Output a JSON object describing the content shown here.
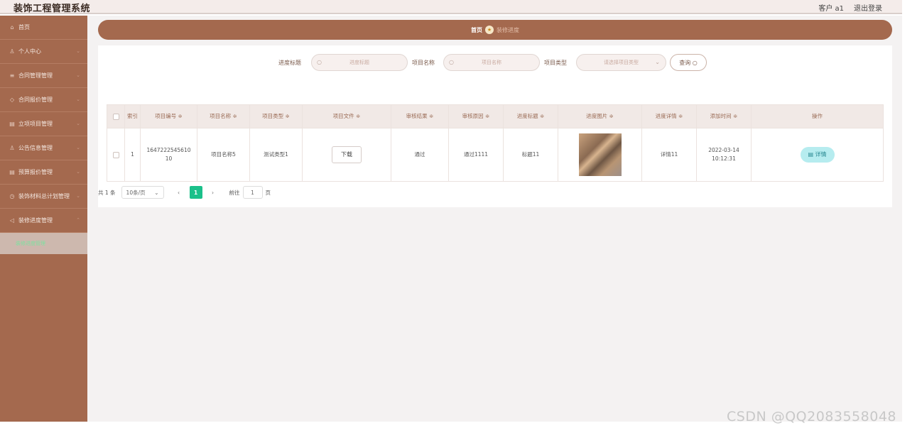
{
  "app": {
    "title": "装饰工程管理系统"
  },
  "topbar": {
    "user": "客户 a1",
    "logout": "退出登录"
  },
  "sidebar": {
    "items": [
      {
        "icon": "⌂",
        "label": "首页"
      },
      {
        "icon": "♙",
        "label": "个人中心"
      },
      {
        "icon": "≡",
        "label": "合同管理管理"
      },
      {
        "icon": "◇",
        "label": "合同报价管理"
      },
      {
        "icon": "▤",
        "label": "立项项目管理"
      },
      {
        "icon": "♙",
        "label": "公告信息管理"
      },
      {
        "icon": "▤",
        "label": "预算报价管理"
      },
      {
        "icon": "◷",
        "label": "装饰材料总计划管理"
      },
      {
        "icon": "◁",
        "label": "装修进度管理"
      }
    ],
    "subitem": "装修进度管理"
  },
  "breadcrumb": {
    "home": "首页",
    "current": "装修进度"
  },
  "search": {
    "title_label": "进度标题",
    "title_placeholder": "进度标题",
    "project_label": "项目名称",
    "project_placeholder": "项目名称",
    "type_label": "项目类型",
    "type_placeholder": "请选择项目类型",
    "query_button": "查询"
  },
  "table": {
    "headers": [
      "索引",
      "项目编号 ≑",
      "项目名称 ≑",
      "项目类型 ≑",
      "项目文件 ≑",
      "审核结果 ≑",
      "审核原因 ≑",
      "进度标题 ≑",
      "进度图片 ≑",
      "进度详情 ≑",
      "添加时间 ≑",
      "操作"
    ],
    "rows": [
      {
        "index": "1",
        "project_no": "1647222545610 10",
        "project_name": "项目名称5",
        "project_type": "测试类型1",
        "file_button": "下载",
        "review_result": "通过",
        "review_reason": "通过1111",
        "progress_title": "标题11",
        "progress_detail": "详情11",
        "added_time": "2022-03-14 10:12:31",
        "action": "详情"
      }
    ]
  },
  "pager": {
    "total": "共 1 条",
    "page_size": "10条/页",
    "current_page": "1",
    "goto_label": "前往",
    "goto_value": "1",
    "page_unit": "页"
  },
  "watermark": "CSDN @QQ2083558048",
  "colors": {
    "sidebar": "#a4694e",
    "accent": "#1bc08a",
    "detail": "#b6ecef"
  }
}
